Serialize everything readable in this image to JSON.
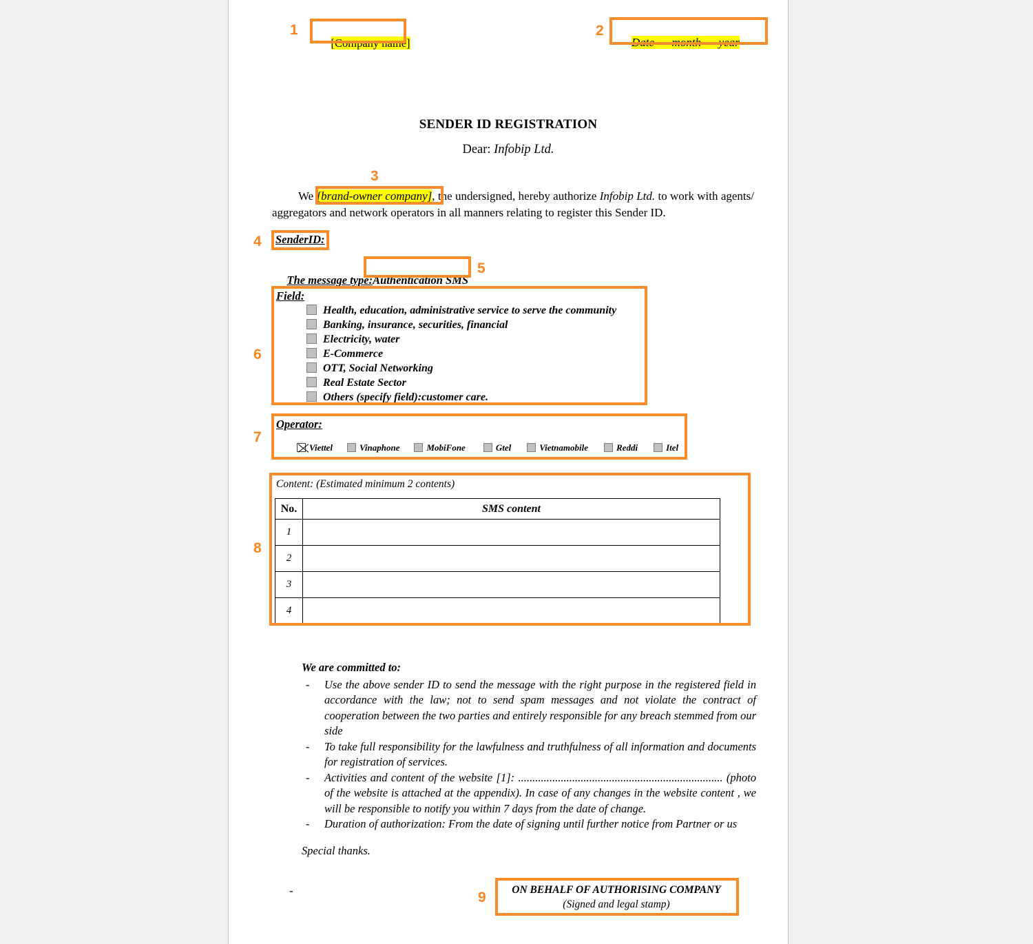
{
  "document": {
    "header": {
      "company_name": "[Company name]",
      "date_line": "Date      month      year"
    },
    "title": "SENDER ID REGISTRATION",
    "dear_label": "Dear:",
    "dear_value": "Infobip Ltd.",
    "paragraph": {
      "before": "We ",
      "brand_owner": "[brand-owner company]",
      "after_1": ", the undersigned, hereby authorize ",
      "authorized_party": "Infobip Ltd.",
      "after_2": " to work with agents/ aggregators and network operators in all manners relating to register this Sender ID."
    },
    "sender_id": {
      "label": "SenderID:",
      "value": ""
    },
    "message_type": {
      "label": "The message type:",
      "value": "Authentication SMS"
    },
    "field": {
      "label": "Field:",
      "options": [
        {
          "label": "Health, education, administrative service to serve the community",
          "checked": false
        },
        {
          "label": "Banking, insurance, securities, financial",
          "checked": false
        },
        {
          "label": "Electricity, water",
          "checked": false
        },
        {
          "label": "E-Commerce",
          "checked": false
        },
        {
          "label": "OTT, Social Networking",
          "checked": false
        },
        {
          "label": "Real Estate Sector",
          "checked": false
        },
        {
          "label": "Others (specify field):customer care.",
          "checked": false
        }
      ]
    },
    "operator": {
      "label": "Operator:",
      "options": [
        {
          "label": "Viettel",
          "checked": true
        },
        {
          "label": "Vinaphone",
          "checked": false
        },
        {
          "label": "MobiFone",
          "checked": false
        },
        {
          "label": "Gtel",
          "checked": false
        },
        {
          "label": "Vietnamobile",
          "checked": false
        },
        {
          "label": "Reddi",
          "checked": false
        },
        {
          "label": "Itel",
          "checked": false
        }
      ]
    },
    "content": {
      "caption": "Content: (Estimated minimum 2 contents)",
      "columns": [
        "No.",
        "SMS content"
      ],
      "rows": [
        {
          "no": "1",
          "sms": ""
        },
        {
          "no": "2",
          "sms": ""
        },
        {
          "no": "3",
          "sms": ""
        },
        {
          "no": "4",
          "sms": ""
        }
      ]
    },
    "commitments": {
      "heading": "We are committed to:",
      "bullet_marker": "-",
      "items": [
        "Use the above sender ID to send the message with the right purpose in the registered field in accordance with the law; not to send spam messages and not violate the contract of cooperation between the two parties and entirely responsible for any breach stemmed from our side",
        "To take full responsibility for the lawfulness and truthfulness of all information and documents for registration of services.",
        "Activities and content of the website [1]: ........................................................................ (photo of the website is attached at the appendix). In case of any changes in the website content , we will be responsible to notify you within 7 days from the date of change.",
        "Duration of authorization: From the date of signing until further notice from Partner or us"
      ],
      "closing": "Special thanks."
    },
    "footer": {
      "stray_dash": "-",
      "signature_line1": "ON BEHALF OF AUTHORISING COMPANY",
      "signature_line2": "(Signed and legal stamp)"
    }
  },
  "annotations": {
    "accent_color": "#f88c2b",
    "number_color": "#f7861f",
    "highlight_color": "#ffff00",
    "markers": [
      {
        "id": "1",
        "target": "company-name"
      },
      {
        "id": "2",
        "target": "date-line"
      },
      {
        "id": "3",
        "target": "brand-owner-company"
      },
      {
        "id": "4",
        "target": "sender-id-label"
      },
      {
        "id": "5",
        "target": "message-type-value"
      },
      {
        "id": "6",
        "target": "field-block"
      },
      {
        "id": "7",
        "target": "operator-block"
      },
      {
        "id": "8",
        "target": "content-block"
      },
      {
        "id": "9",
        "target": "signature-block"
      }
    ]
  }
}
